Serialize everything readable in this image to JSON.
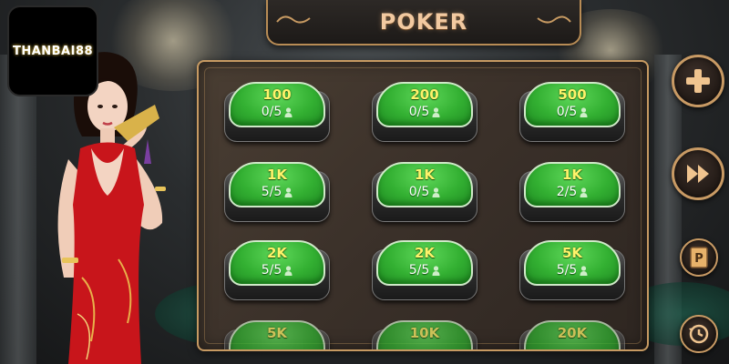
{
  "logo": {
    "text": "THANBAI88"
  },
  "title": "POKER",
  "tables": [
    {
      "stake": "100",
      "seats": "0/5"
    },
    {
      "stake": "200",
      "seats": "0/5"
    },
    {
      "stake": "500",
      "seats": "0/5"
    },
    {
      "stake": "1K",
      "seats": "5/5"
    },
    {
      "stake": "1K",
      "seats": "0/5"
    },
    {
      "stake": "1K",
      "seats": "2/5"
    },
    {
      "stake": "2K",
      "seats": "5/5"
    },
    {
      "stake": "2K",
      "seats": "5/5"
    },
    {
      "stake": "5K",
      "seats": "5/5"
    },
    {
      "stake": "5K",
      "seats": ""
    },
    {
      "stake": "10K",
      "seats": ""
    },
    {
      "stake": "20K",
      "seats": ""
    }
  ],
  "side_buttons": [
    {
      "name": "add-table-button",
      "icon": "plus-icon"
    },
    {
      "name": "quick-play-button",
      "icon": "fast-forward-icon"
    },
    {
      "name": "rules-button",
      "icon": "card-book-icon"
    },
    {
      "name": "history-button",
      "icon": "history-icon"
    }
  ],
  "colors": {
    "table_felt": "#33b032",
    "stake_text": "#fff36a",
    "panel_border": "#c79a62",
    "title_text": "#f2c9a0"
  }
}
